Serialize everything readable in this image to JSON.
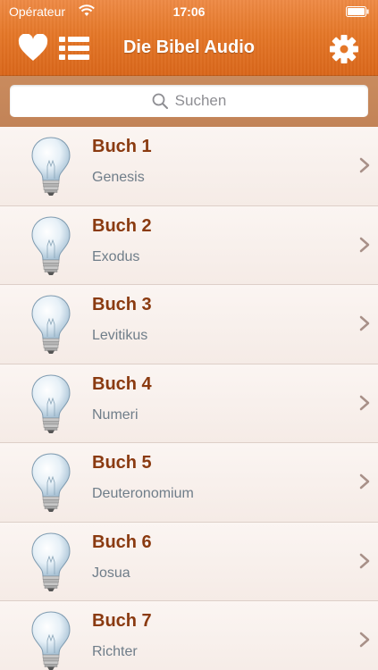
{
  "status_bar": {
    "carrier": "Opérateur",
    "time": "17:06"
  },
  "nav": {
    "title": "Die Bibel Audio",
    "left_icons": [
      "heart-icon",
      "list-icon"
    ],
    "right_icon": "gear-icon"
  },
  "search": {
    "placeholder": "Suchen"
  },
  "books": [
    {
      "label": "Buch 1",
      "name": "Genesis"
    },
    {
      "label": "Buch 2",
      "name": "Exodus"
    },
    {
      "label": "Buch 3",
      "name": "Levitikus"
    },
    {
      "label": "Buch 4",
      "name": "Numeri"
    },
    {
      "label": "Buch 5",
      "name": "Deuteronomium"
    },
    {
      "label": "Buch 6",
      "name": "Josua"
    },
    {
      "label": "Buch 7",
      "name": "Richter"
    }
  ],
  "colors": {
    "header_orange": "#e47728",
    "search_band": "#c98b5e",
    "book_label": "#8a3a10",
    "book_name": "#6f7d89"
  }
}
